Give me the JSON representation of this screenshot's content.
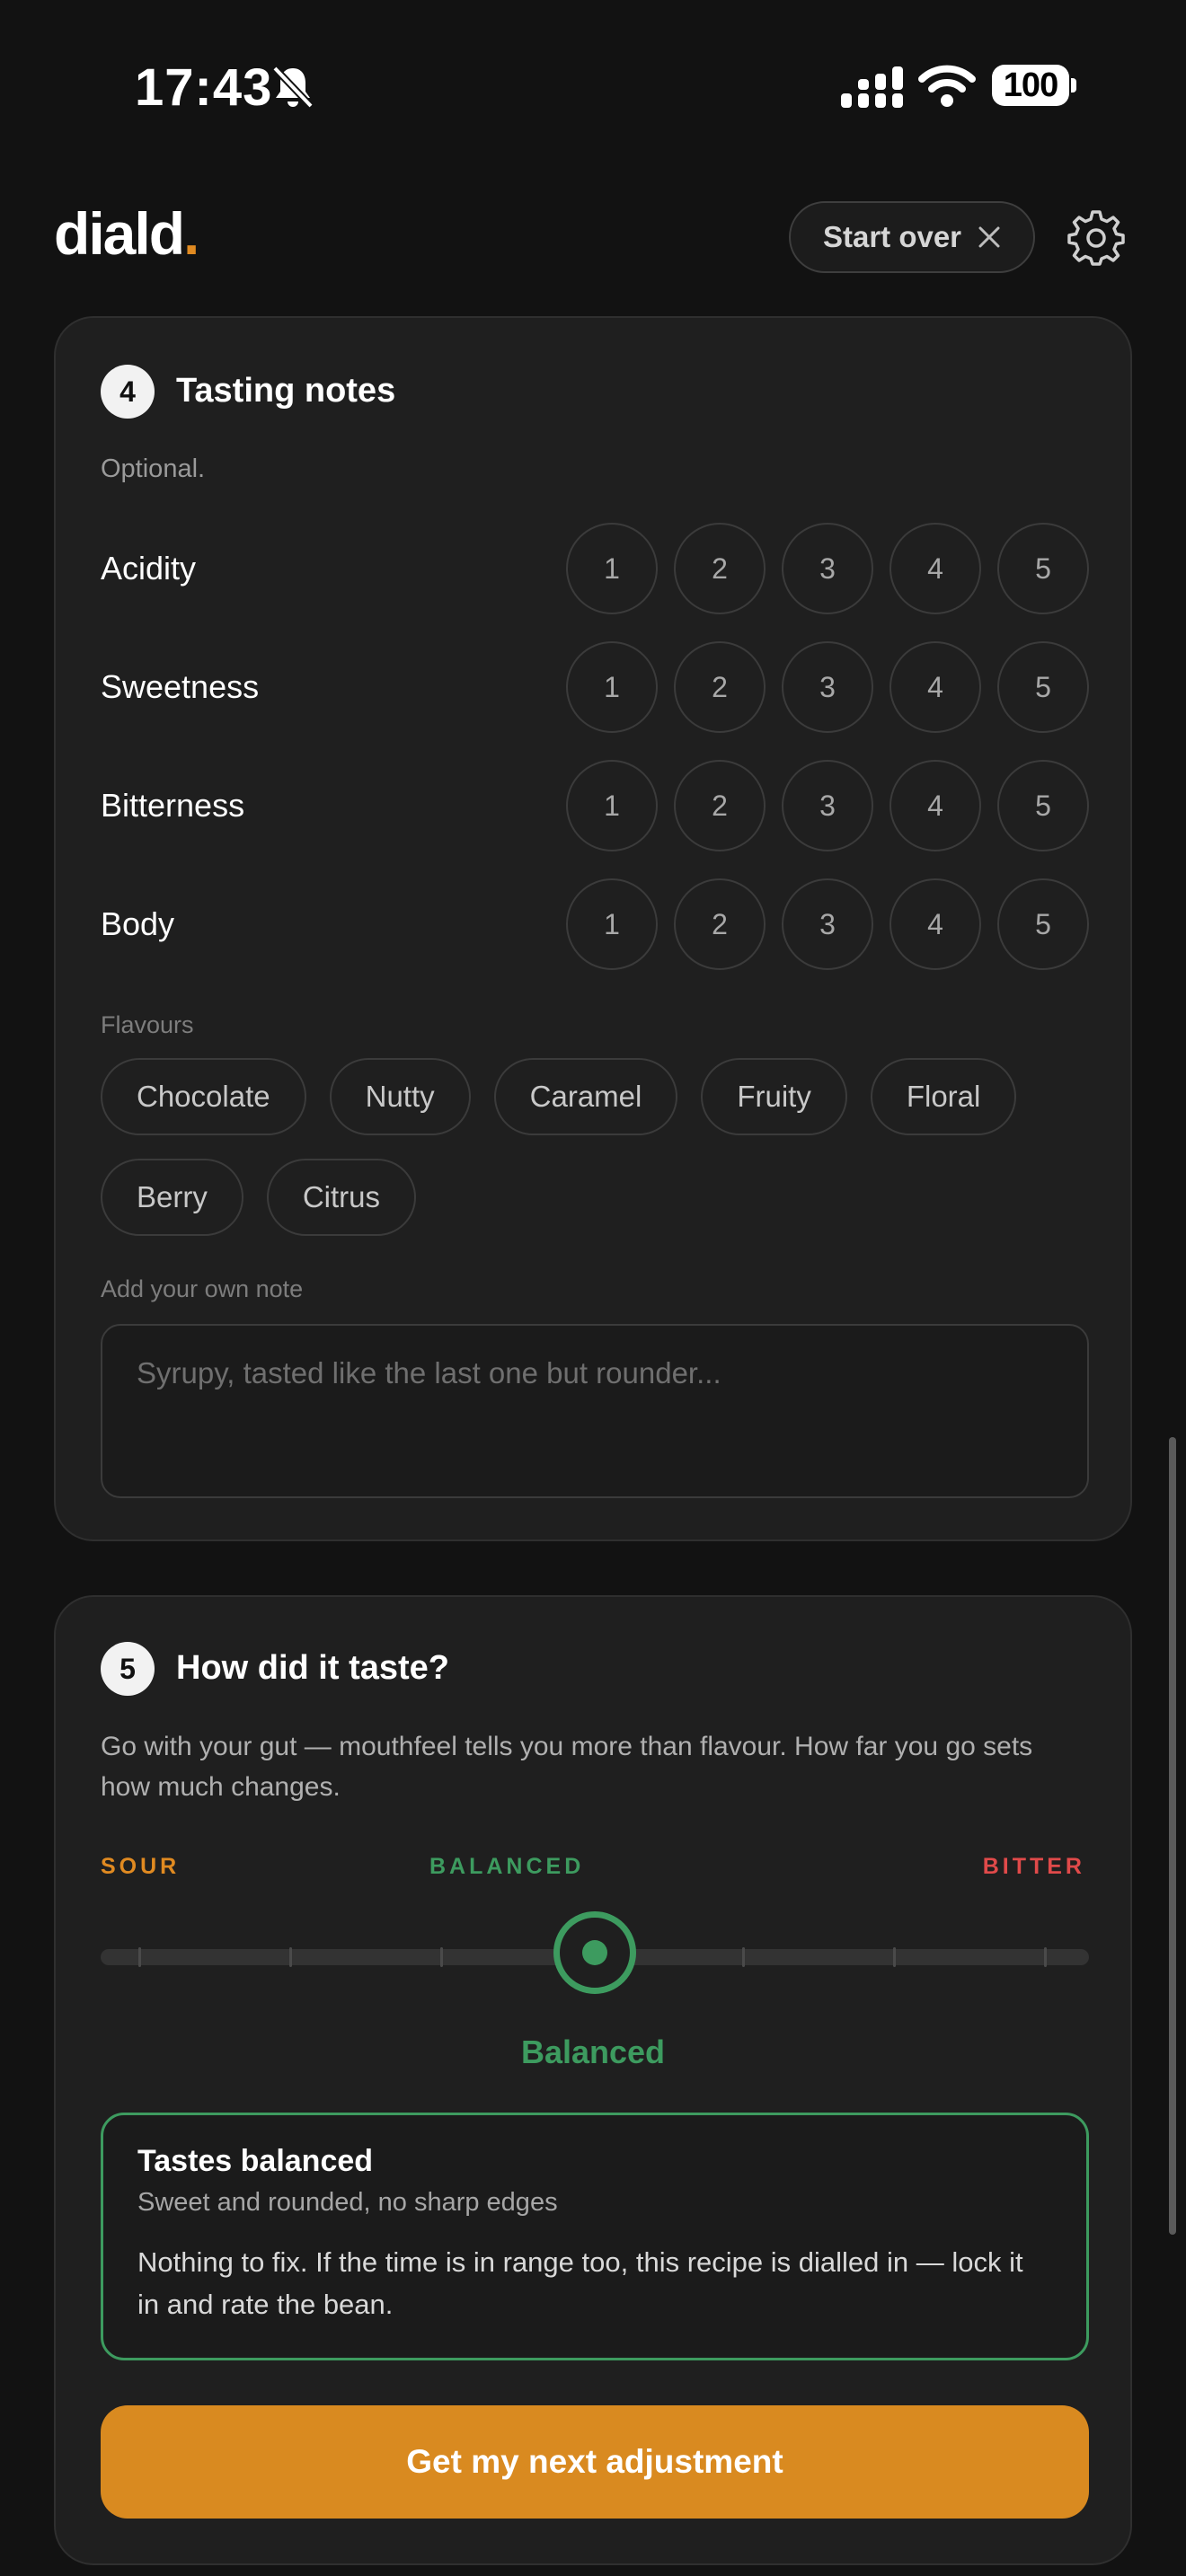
{
  "status_bar": {
    "time": "17:43",
    "battery": "100",
    "icons": [
      "bell-slash-icon",
      "cellular-signal-icon",
      "wifi-icon",
      "battery-icon"
    ]
  },
  "header": {
    "logo": "diald",
    "logo_dot": ".",
    "start_over_label": "Start over",
    "icons": [
      "close-icon",
      "gear-icon"
    ]
  },
  "tasting": {
    "step": "4",
    "title": "Tasting notes",
    "subtitle": "Optional.",
    "ratings": [
      {
        "label": "Acidity",
        "options": [
          "1",
          "2",
          "3",
          "4",
          "5"
        ]
      },
      {
        "label": "Sweetness",
        "options": [
          "1",
          "2",
          "3",
          "4",
          "5"
        ]
      },
      {
        "label": "Bitterness",
        "options": [
          "1",
          "2",
          "3",
          "4",
          "5"
        ]
      },
      {
        "label": "Body",
        "options": [
          "1",
          "2",
          "3",
          "4",
          "5"
        ]
      }
    ],
    "flavours_label": "Flavours",
    "flavours": [
      "Chocolate",
      "Nutty",
      "Caramel",
      "Fruity",
      "Floral",
      "Berry",
      "Citrus"
    ],
    "note_label": "Add your own note",
    "note_placeholder": "Syrupy, tasted like the last one but rounder..."
  },
  "taste": {
    "step": "5",
    "title": "How did it taste?",
    "description": "Go with your gut — mouthfeel tells you more than flavour. How far you go sets how much changes.",
    "scale_sour": "SOUR",
    "scale_balanced": "BALANCED",
    "scale_bitter": "BITTER",
    "slider_position": 0.5,
    "slider_value": "Balanced",
    "result_title": "Tastes balanced",
    "result_subtitle": "Sweet and rounded, no sharp edges",
    "result_body": "Nothing to fix. If the time is in range too, this recipe is dialled in — lock it in and rate the bean.",
    "cta_label": "Get my next adjustment"
  },
  "colors": {
    "accent": "#e08a21",
    "balanced": "#3d9b5f",
    "bitter": "#e04a4a",
    "cta": "#d98a20",
    "background": "#121212",
    "card": "#1f1f1f"
  }
}
